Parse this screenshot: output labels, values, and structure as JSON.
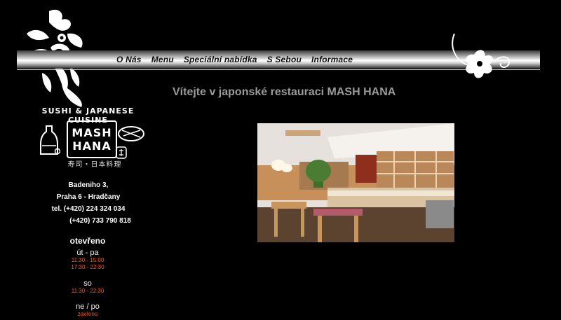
{
  "nav": {
    "items": [
      {
        "label": "O Nás"
      },
      {
        "label": "Menu"
      },
      {
        "label": "Speciální nabídka"
      },
      {
        "label": "S Sebou"
      },
      {
        "label": "Informace"
      }
    ]
  },
  "brand": {
    "tagline": "SUSHI & JAPANESE CUISINE",
    "logo_line1": "MASH",
    "logo_line2": "HANA",
    "japanese_sub": "寿司・日本料理"
  },
  "address": {
    "street": "Badeniho 3,",
    "city": "Praha 6 - Hradčany",
    "phone1": "tel. (+420) 224 324 034",
    "phone2": "(+420) 733 790 818"
  },
  "hours": {
    "title": "otevřeno",
    "blocks": [
      {
        "day": "út - pa",
        "times": [
          "11:30 - 15:00",
          "17:30 - 22:30"
        ]
      },
      {
        "day": "so",
        "times": [
          "11:30 - 22:30"
        ]
      },
      {
        "day": "ne / po",
        "times": [
          "zavřeno"
        ]
      }
    ]
  },
  "main": {
    "welcome": "Vítejte v japonské restauraci MASH HANA"
  },
  "colors": {
    "background": "#000000",
    "welcome_text": "#9a9a9a",
    "hours_time": "#ff5a1a"
  }
}
